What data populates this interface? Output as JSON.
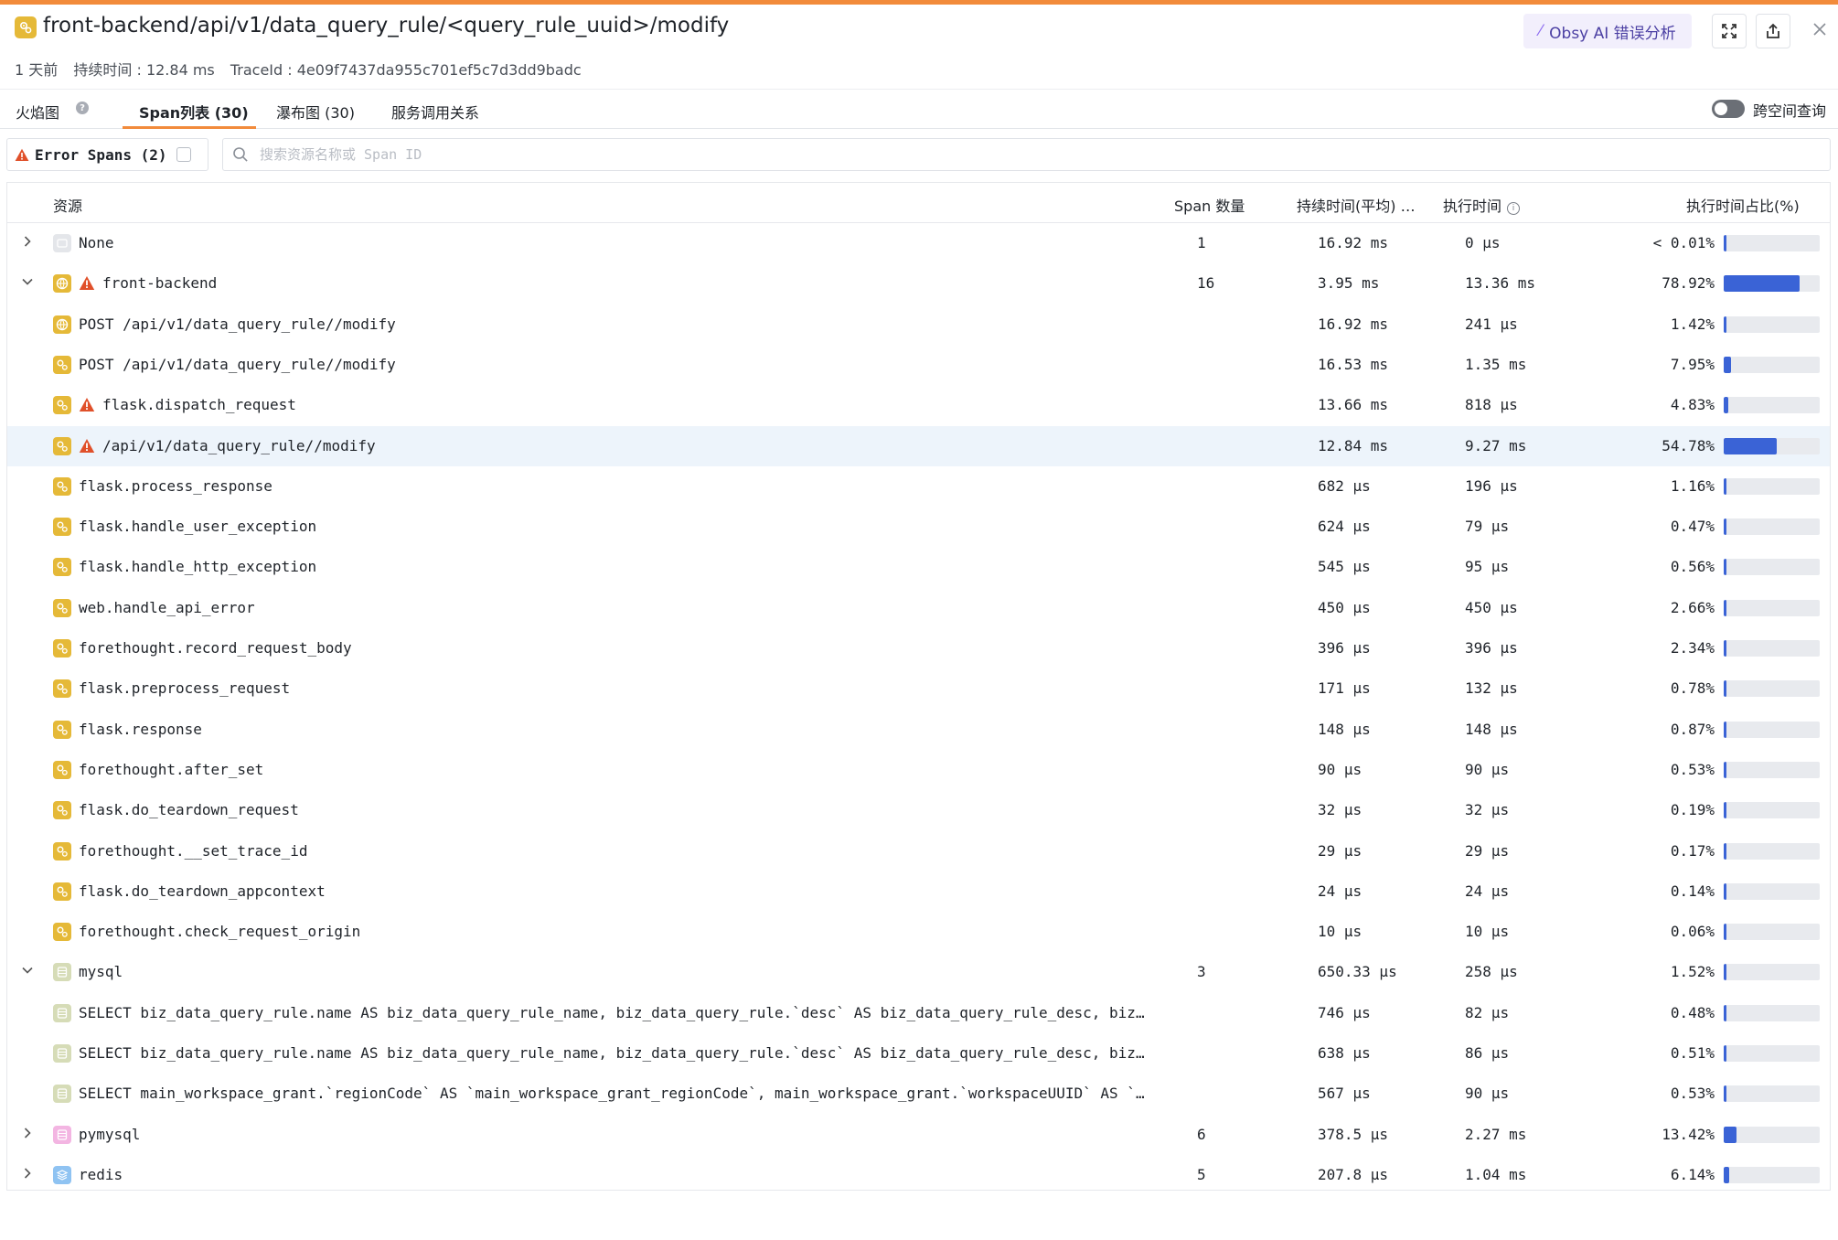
{
  "header": {
    "service": "front-backend",
    "path": "/api/v1/data_query_rule/<query_rule_uuid>/modify",
    "time_ago": "1 天前",
    "duration": "持续时间 : 12.84 ms",
    "trace_id": "TraceId : 4e09f7437da955c701ef5c7d3dd9badc",
    "ai_button": "Obsy AI 错误分析"
  },
  "tabs": {
    "flame": "火焰图",
    "span_list": "Span列表 (30)",
    "waterfall": "瀑布图 (30)",
    "service_map": "服务调用关系",
    "cross_workspace": "跨空间查询"
  },
  "filters": {
    "error_spans": "Error Spans (2)",
    "search_placeholder": "搜索资源名称或 Span ID"
  },
  "columns": {
    "resource": "资源",
    "span_count": "Span 数量",
    "avg_duration": "持续时间(平均) …",
    "exec_time": "执行时间",
    "exec_pct": "执行时间占比(%)"
  },
  "colors": {
    "accent": "#f28b3b",
    "bar": "#3a63d6",
    "error": "#e0502a",
    "highlight_row": "#edf4fb"
  },
  "rows": [
    {
      "name": "None",
      "count": "1",
      "avg": "16.92 ms",
      "exec": "0 µs",
      "pct": "< 0.01%",
      "ratio": 0.0001,
      "level": 0,
      "chevron": "right",
      "icon": "none",
      "warn": false,
      "highlight": false
    },
    {
      "name": "front-backend",
      "count": "16",
      "avg": "3.95 ms",
      "exec": "13.36 ms",
      "pct": "78.92%",
      "ratio": 0.7892,
      "level": 0,
      "chevron": "down",
      "icon": "web-globe",
      "warn": true,
      "highlight": false
    },
    {
      "name": "POST /api/v1/data_query_rule//modify",
      "count": "",
      "avg": "16.92 ms",
      "exec": "241 µs",
      "pct": "1.42%",
      "ratio": 0.0142,
      "level": 1,
      "chevron": "",
      "icon": "web-globe",
      "warn": false,
      "highlight": false
    },
    {
      "name": "POST /api/v1/data_query_rule//modify",
      "count": "",
      "avg": "16.53 ms",
      "exec": "1.35 ms",
      "pct": "7.95%",
      "ratio": 0.0795,
      "level": 1,
      "chevron": "",
      "icon": "web-gears",
      "warn": false,
      "highlight": false
    },
    {
      "name": "flask.dispatch_request",
      "count": "",
      "avg": "13.66 ms",
      "exec": "818 µs",
      "pct": "4.83%",
      "ratio": 0.0483,
      "level": 1,
      "chevron": "",
      "icon": "web-gears",
      "warn": true,
      "highlight": false
    },
    {
      "name": "/api/v1/data_query_rule//modify",
      "count": "",
      "avg": "12.84 ms",
      "exec": "9.27 ms",
      "pct": "54.78%",
      "ratio": 0.5478,
      "level": 1,
      "chevron": "",
      "icon": "web-gears",
      "warn": true,
      "highlight": true
    },
    {
      "name": "flask.process_response",
      "count": "",
      "avg": "682 µs",
      "exec": "196 µs",
      "pct": "1.16%",
      "ratio": 0.0116,
      "level": 1,
      "chevron": "",
      "icon": "web-gears",
      "warn": false,
      "highlight": false
    },
    {
      "name": "flask.handle_user_exception",
      "count": "",
      "avg": "624 µs",
      "exec": "79 µs",
      "pct": "0.47%",
      "ratio": 0.0047,
      "level": 1,
      "chevron": "",
      "icon": "web-gears",
      "warn": false,
      "highlight": false
    },
    {
      "name": "flask.handle_http_exception",
      "count": "",
      "avg": "545 µs",
      "exec": "95 µs",
      "pct": "0.56%",
      "ratio": 0.0056,
      "level": 1,
      "chevron": "",
      "icon": "web-gears",
      "warn": false,
      "highlight": false
    },
    {
      "name": "web.handle_api_error",
      "count": "",
      "avg": "450 µs",
      "exec": "450 µs",
      "pct": "2.66%",
      "ratio": 0.0266,
      "level": 1,
      "chevron": "",
      "icon": "web-gears",
      "warn": false,
      "highlight": false
    },
    {
      "name": "forethought.record_request_body",
      "count": "",
      "avg": "396 µs",
      "exec": "396 µs",
      "pct": "2.34%",
      "ratio": 0.0234,
      "level": 1,
      "chevron": "",
      "icon": "web-gears",
      "warn": false,
      "highlight": false
    },
    {
      "name": "flask.preprocess_request",
      "count": "",
      "avg": "171 µs",
      "exec": "132 µs",
      "pct": "0.78%",
      "ratio": 0.0078,
      "level": 1,
      "chevron": "",
      "icon": "web-gears",
      "warn": false,
      "highlight": false
    },
    {
      "name": "flask.response",
      "count": "",
      "avg": "148 µs",
      "exec": "148 µs",
      "pct": "0.87%",
      "ratio": 0.0087,
      "level": 1,
      "chevron": "",
      "icon": "web-gears",
      "warn": false,
      "highlight": false
    },
    {
      "name": "forethought.after_set",
      "count": "",
      "avg": "90 µs",
      "exec": "90 µs",
      "pct": "0.53%",
      "ratio": 0.0053,
      "level": 1,
      "chevron": "",
      "icon": "web-gears",
      "warn": false,
      "highlight": false
    },
    {
      "name": "flask.do_teardown_request",
      "count": "",
      "avg": "32 µs",
      "exec": "32 µs",
      "pct": "0.19%",
      "ratio": 0.0019,
      "level": 1,
      "chevron": "",
      "icon": "web-gears",
      "warn": false,
      "highlight": false
    },
    {
      "name": "forethought.__set_trace_id",
      "count": "",
      "avg": "29 µs",
      "exec": "29 µs",
      "pct": "0.17%",
      "ratio": 0.0017,
      "level": 1,
      "chevron": "",
      "icon": "web-gears",
      "warn": false,
      "highlight": false
    },
    {
      "name": "flask.do_teardown_appcontext",
      "count": "",
      "avg": "24 µs",
      "exec": "24 µs",
      "pct": "0.14%",
      "ratio": 0.0014,
      "level": 1,
      "chevron": "",
      "icon": "web-gears",
      "warn": false,
      "highlight": false
    },
    {
      "name": "forethought.check_request_origin",
      "count": "",
      "avg": "10 µs",
      "exec": "10 µs",
      "pct": "0.06%",
      "ratio": 0.0006,
      "level": 1,
      "chevron": "",
      "icon": "web-gears",
      "warn": false,
      "highlight": false
    },
    {
      "name": "mysql",
      "count": "3",
      "avg": "650.33 µs",
      "exec": "258 µs",
      "pct": "1.52%",
      "ratio": 0.0152,
      "level": 0,
      "chevron": "down",
      "icon": "db",
      "warn": false,
      "highlight": false
    },
    {
      "name": "SELECT biz_data_query_rule.name AS biz_data_query_rule_name, biz_data_query_rule.`desc` AS biz_data_query_rule_desc, biz…",
      "count": "",
      "avg": "746 µs",
      "exec": "82 µs",
      "pct": "0.48%",
      "ratio": 0.0048,
      "level": 1,
      "chevron": "",
      "icon": "db",
      "warn": false,
      "highlight": false
    },
    {
      "name": "SELECT biz_data_query_rule.name AS biz_data_query_rule_name, biz_data_query_rule.`desc` AS biz_data_query_rule_desc, biz…",
      "count": "",
      "avg": "638 µs",
      "exec": "86 µs",
      "pct": "0.51%",
      "ratio": 0.0051,
      "level": 1,
      "chevron": "",
      "icon": "db",
      "warn": false,
      "highlight": false
    },
    {
      "name": "SELECT main_workspace_grant.`regionCode` AS `main_workspace_grant_regionCode`, main_workspace_grant.`workspaceUUID` AS `…",
      "count": "",
      "avg": "567 µs",
      "exec": "90 µs",
      "pct": "0.53%",
      "ratio": 0.0053,
      "level": 1,
      "chevron": "",
      "icon": "db",
      "warn": false,
      "highlight": false
    },
    {
      "name": "pymysql",
      "count": "6",
      "avg": "378.5 µs",
      "exec": "2.27 ms",
      "pct": "13.42%",
      "ratio": 0.1342,
      "level": 0,
      "chevron": "right",
      "icon": "pymysql",
      "warn": false,
      "highlight": false
    },
    {
      "name": "redis",
      "count": "5",
      "avg": "207.8 µs",
      "exec": "1.04 ms",
      "pct": "6.14%",
      "ratio": 0.0614,
      "level": 0,
      "chevron": "right",
      "icon": "redis",
      "warn": false,
      "highlight": false
    }
  ]
}
